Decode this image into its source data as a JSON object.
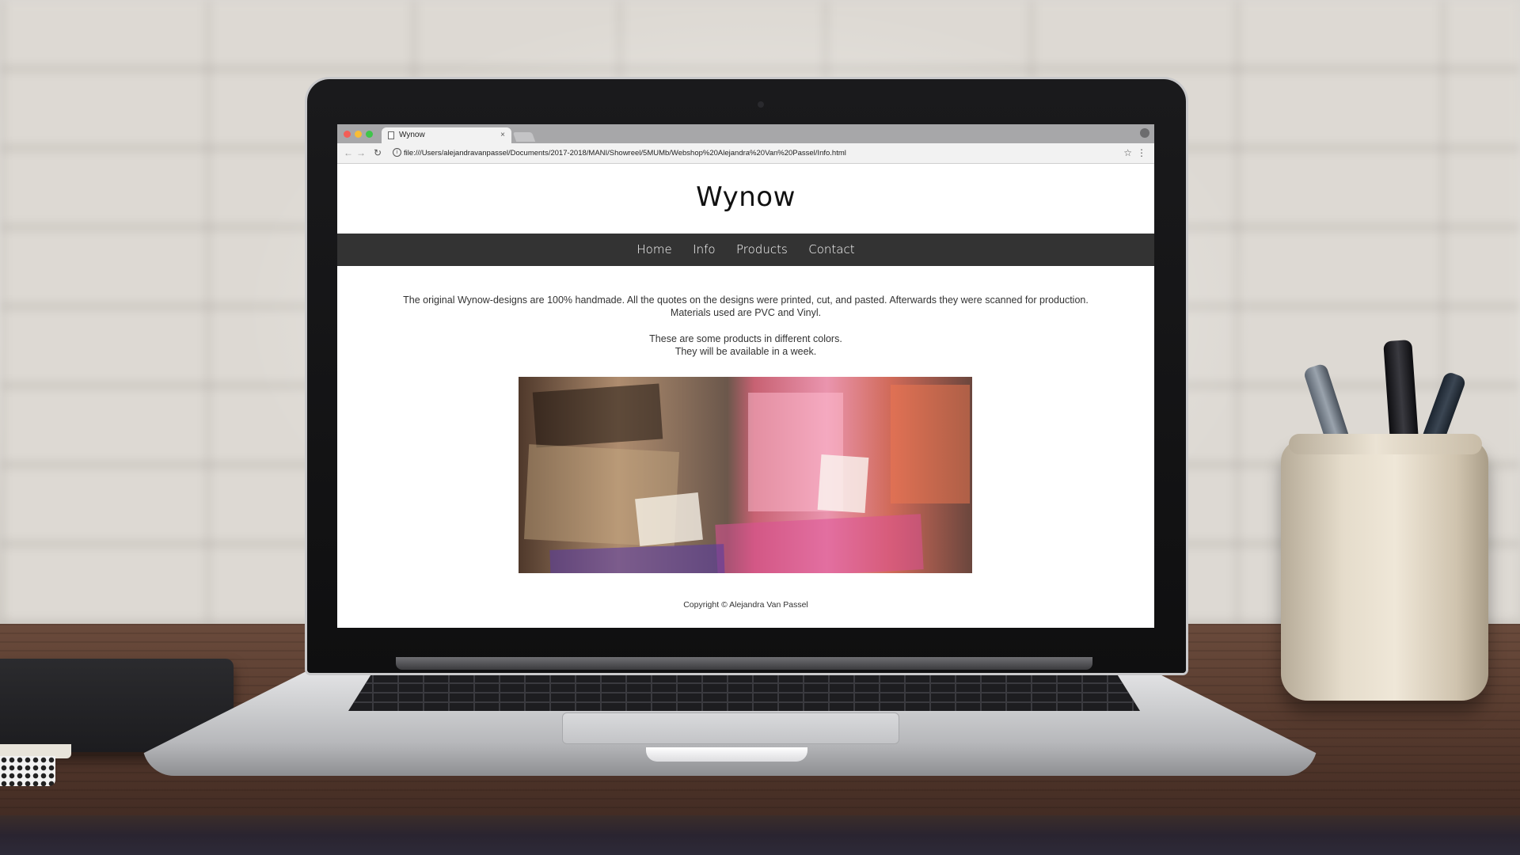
{
  "browser": {
    "tab_title": "Wynow",
    "tab_close": "×",
    "url": "file:///Users/alejandravanpassel/Documents/2017-2018/MANI/Showreel/5MUMb/Webshop%20Alejandra%20Van%20Passel/Info.html",
    "icons": {
      "back": "←",
      "forward": "→",
      "reload": "↻",
      "info": "i",
      "star": "☆",
      "menu": "⋮"
    }
  },
  "site": {
    "title": "Wynow",
    "nav": [
      "Home",
      "Info",
      "Products",
      "Contact"
    ],
    "paragraph1_line1": "The original Wynow-designs are 100% handmade. All the quotes on the designs were printed, cut, and pasted. Afterwards they were scanned for production.",
    "paragraph1_line2": "Materials used are PVC and Vinyl.",
    "paragraph2_line1": "These are some products in different colors.",
    "paragraph2_line2": "They will be available in a week.",
    "footer": "Copyright © Alejandra Van Passel"
  }
}
